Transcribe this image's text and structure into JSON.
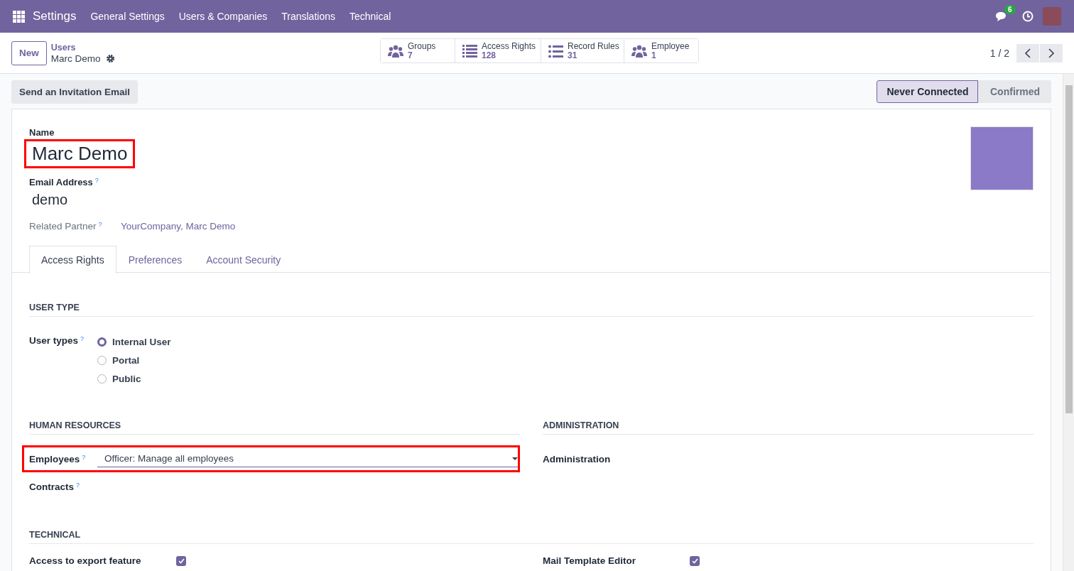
{
  "navbar": {
    "app": "Settings",
    "menus": [
      "General Settings",
      "Users & Companies",
      "Translations",
      "Technical"
    ],
    "message_count": "6"
  },
  "breadcrumb": {
    "new_button": "New",
    "parent": "Users",
    "current": "Marc Demo"
  },
  "smart_buttons": [
    {
      "kind": "people",
      "label": "Groups",
      "value": "7"
    },
    {
      "kind": "list",
      "label": "Access Rights",
      "value": "128"
    },
    {
      "kind": "bullets",
      "label": "Record Rules",
      "value": "31"
    },
    {
      "kind": "people",
      "label": "Employee",
      "value": "1"
    }
  ],
  "pager": "1 / 2",
  "action_buttons": [
    "Send an Invitation Email"
  ],
  "statusbar": [
    {
      "label": "Never Connected",
      "selected": true
    },
    {
      "label": "Confirmed",
      "selected": false
    }
  ],
  "form": {
    "name_label": "Name",
    "name": "Marc Demo",
    "name_highlighted": true,
    "email_label": "Email Address",
    "email_help": "?",
    "email": "demo",
    "partner_label": "Related Partner",
    "partner_help": "?",
    "partner": "YourCompany, Marc Demo"
  },
  "tabs": [
    {
      "label": "Access Rights",
      "selected": true
    },
    {
      "label": "Preferences",
      "selected": false
    },
    {
      "label": "Account Security",
      "selected": false
    }
  ],
  "user_type": {
    "heading": "USER TYPE",
    "label": "User types",
    "help": "?",
    "options": [
      {
        "label": "Internal User",
        "selected": true
      },
      {
        "label": "Portal",
        "selected": false
      },
      {
        "label": "Public",
        "selected": false
      }
    ]
  },
  "human_resources": {
    "heading": "HUMAN RESOURCES",
    "fields": [
      {
        "kind": "select",
        "label": "Employees",
        "help": "?",
        "value": "Officer: Manage all employees",
        "highlighted": true
      },
      {
        "kind": "empty",
        "label": "Contracts",
        "help": "?"
      }
    ]
  },
  "administration": {
    "heading": "ADMINISTRATION",
    "fields": [
      {
        "label": "Administration"
      }
    ]
  },
  "technical": {
    "heading": "TECHNICAL",
    "items": [
      {
        "label": "Access to export feature",
        "checked": true
      },
      {
        "label": "Mail Template Editor",
        "checked": true
      }
    ]
  }
}
